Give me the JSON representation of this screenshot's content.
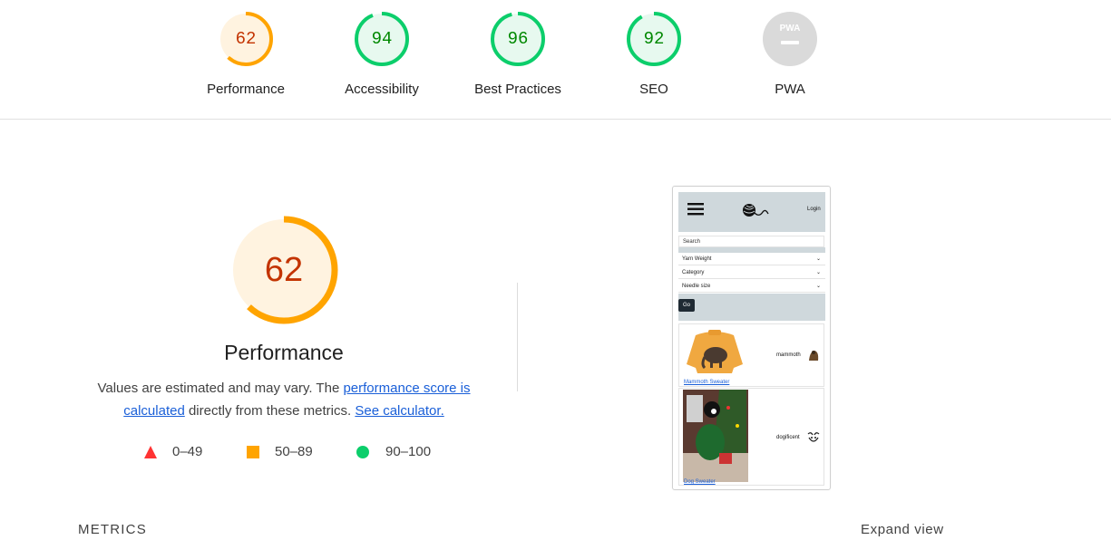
{
  "colors": {
    "fail": "#ff3333",
    "average": "#ffa400",
    "pass": "#0cce6b",
    "average_text": "#c33300",
    "pass_text": "#008800",
    "pwa": "#c7c7c7",
    "link": "#1a5fd8"
  },
  "categories": [
    {
      "label": "Performance",
      "score": "62",
      "fraction": 0.62,
      "status": "average"
    },
    {
      "label": "Accessibility",
      "score": "94",
      "fraction": 0.94,
      "status": "pass"
    },
    {
      "label": "Best Practices",
      "score": "96",
      "fraction": 0.96,
      "status": "pass"
    },
    {
      "label": "SEO",
      "score": "92",
      "fraction": 0.92,
      "status": "pass"
    },
    {
      "label": "PWA",
      "badge": "PWA",
      "status": "na"
    }
  ],
  "performance": {
    "score": "62",
    "fraction": 0.62,
    "title": "Performance",
    "desc_prefix": "Values are estimated and may vary. The ",
    "link1": "performance score is calculated",
    "desc_middle": " directly from these metrics. ",
    "link2": "See calculator."
  },
  "legend": [
    {
      "icon": "triangle-fail-icon",
      "range": "0–49"
    },
    {
      "icon": "square-average-icon",
      "range": "50–89"
    },
    {
      "icon": "circle-pass-icon",
      "range": "90–100"
    }
  ],
  "thumbnail": {
    "login": "Login",
    "search_placeholder": "Search",
    "filters": [
      "Yarn Weight",
      "Category",
      "Needle size"
    ],
    "go": "Go",
    "products": [
      {
        "link": "Mammoth Sweater",
        "name": "mammoth"
      },
      {
        "link": "Dog Sweater",
        "name": "dogificent"
      }
    ]
  },
  "metrics_label": "METRICS",
  "expand_view": "Expand view"
}
